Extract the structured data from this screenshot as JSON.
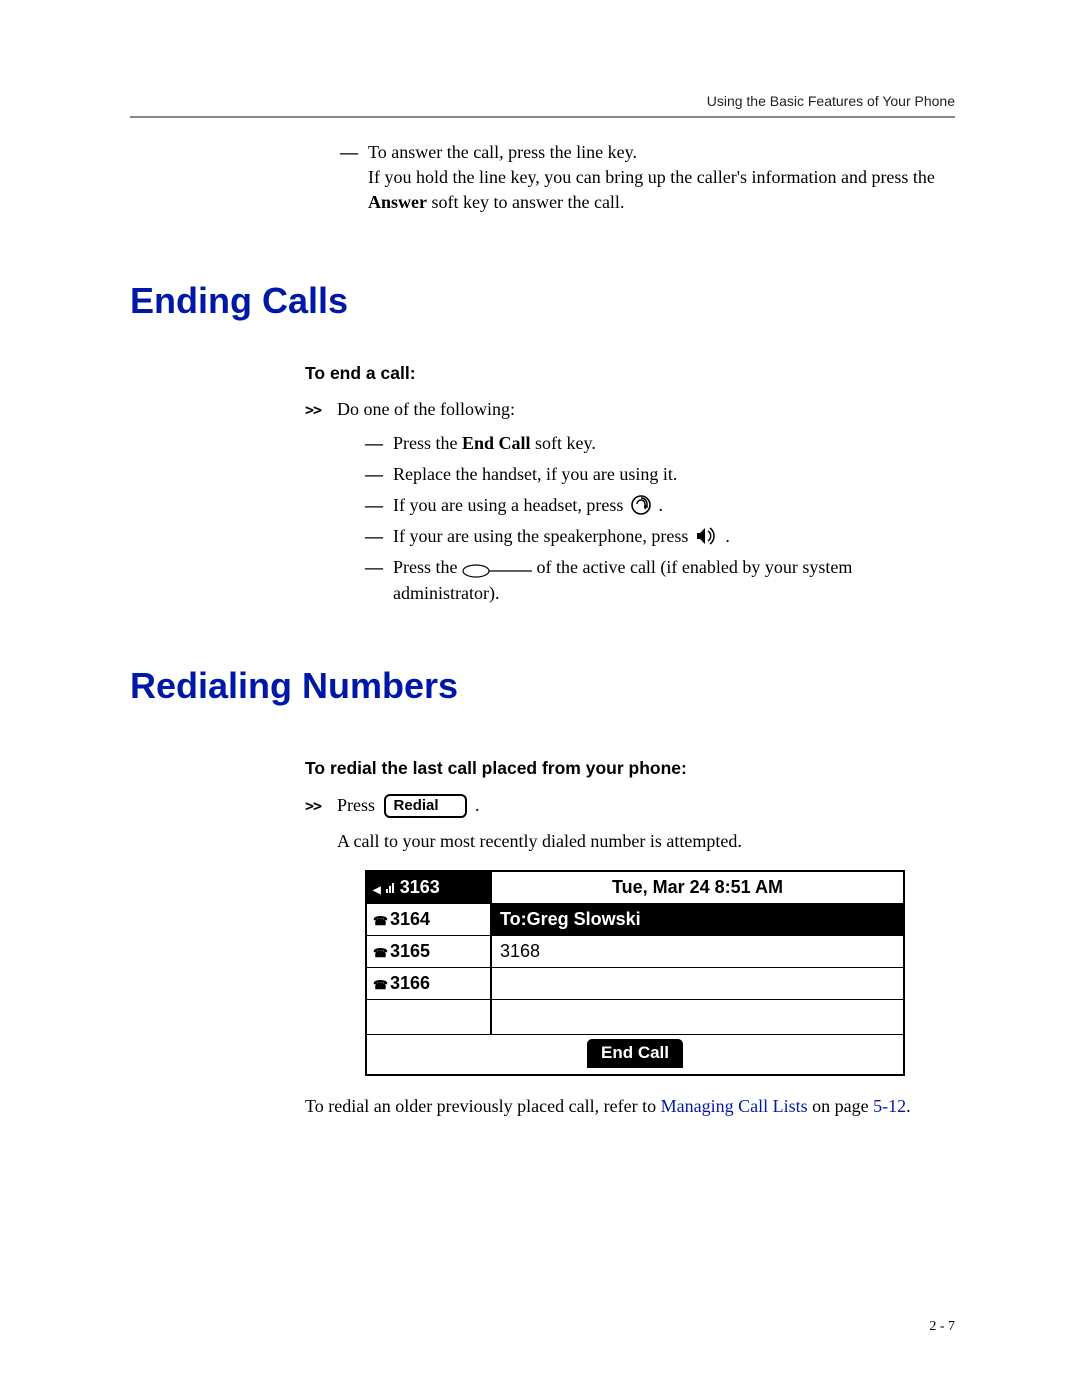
{
  "header": "Using the Basic Features of Your Phone",
  "intro": {
    "item1": "To answer the call, press the line key.",
    "item1b_a": "If you hold the line key, you can bring up the caller's information and press the ",
    "item1b_b": "Answer",
    "item1b_c": " soft key to answer the call."
  },
  "ending": {
    "heading": "Ending Calls",
    "subhead": "To end a call:",
    "lead": "Do one of the following:",
    "i1a": "Press the ",
    "i1b": "End Call",
    "i1c": " soft key.",
    "i2": "Replace the handset, if you are using it.",
    "i3": "If you are using a headset, press ",
    "i4": "If your are using the speakerphone, press ",
    "i5a": "Press the ",
    "i5b": " of the active call (if enabled by your system administrator)."
  },
  "redial": {
    "heading": "Redialing Numbers",
    "subhead": "To redial the last call placed from your phone:",
    "press": "Press ",
    "btn": "Redial",
    "after": "A call to your most recently dialed number is attempted.",
    "footer_a": "To redial an older previously placed call, refer to ",
    "footer_link": "Managing Call Lists",
    "footer_b": " on page ",
    "footer_page": "5-12",
    "footer_c": "."
  },
  "screen": {
    "date": "Tue, Mar 24  8:51 AM",
    "line1": "3163",
    "line2": "3164",
    "line3": "3165",
    "line4": "3166",
    "to": "To:Greg Slowski",
    "num": "3168",
    "softkey": "End Call"
  },
  "pagenum": "2 - 7",
  "period": " ."
}
